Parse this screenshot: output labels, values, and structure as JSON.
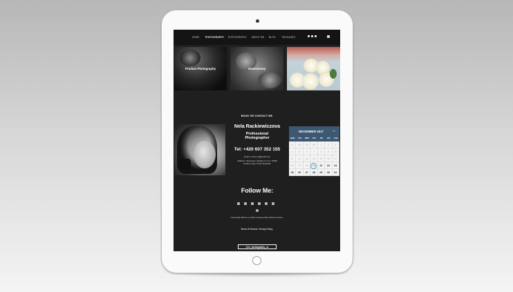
{
  "nav": {
    "items": [
      "HOME",
      "PHOTOGRAPHY",
      "PHOTOGRAPHY",
      "ABOUT ME",
      "BLOG",
      "PACKAGES"
    ],
    "active_index": 1,
    "icons": [
      "facebook-icon",
      "youtube-icon",
      "instagram-icon",
      "cart-icon"
    ]
  },
  "gallery": {
    "tiles": [
      {
        "caption": "Product Photography"
      },
      {
        "caption": "Gastronomy"
      },
      {
        "caption": ""
      }
    ]
  },
  "book_title": "BOOK OR CONTACT ME",
  "contact": {
    "name": "Nela Rackiewiczova",
    "role_line1": "Professional",
    "role_line2": "Photographer",
    "phone": "Tel: +420 607 352 155",
    "email": "Email: nr.foto.cz@gmail.com",
    "address_line1": "Address: Stresovice, Ruska 4 no.17, 16200",
    "address_line2": "Kerkovy Vary Czech Republic"
  },
  "calendar": {
    "month": "DECEMBER 2017",
    "weekdays": [
      "MON",
      "TUE",
      "WED",
      "THU",
      "FRI",
      "SAT",
      "SUN"
    ],
    "rows": [
      [
        "27",
        "28",
        "29",
        "30",
        "1",
        "2",
        "3"
      ],
      [
        "4",
        "5",
        "6",
        "7",
        "8",
        "9",
        "10"
      ],
      [
        "11",
        "12",
        "13",
        "14",
        "15",
        "16",
        "17"
      ],
      [
        "18",
        "19",
        "20",
        "21",
        "22",
        "23",
        "24"
      ],
      [
        "25",
        "26",
        "27",
        "28",
        "29",
        "30",
        "31"
      ]
    ],
    "today": "21"
  },
  "follow_title": "Follow Me:",
  "social_icons": [
    "facebook-icon",
    "twitter-icon",
    "instagram-icon",
    "youtube-icon",
    "google-plus-icon",
    "skype-icon",
    "pinterest-icon"
  ],
  "footer": {
    "owned": "Owned By NRfoto (c) 2018. Designed By GRXinnovative.",
    "terms": "Terms Of Service. Privacy Policy.",
    "instagram_handle": "@nr_photography_cz"
  },
  "colors": {
    "calendar_header": "#3d5873",
    "screen_bg": "#1f1f1f"
  }
}
